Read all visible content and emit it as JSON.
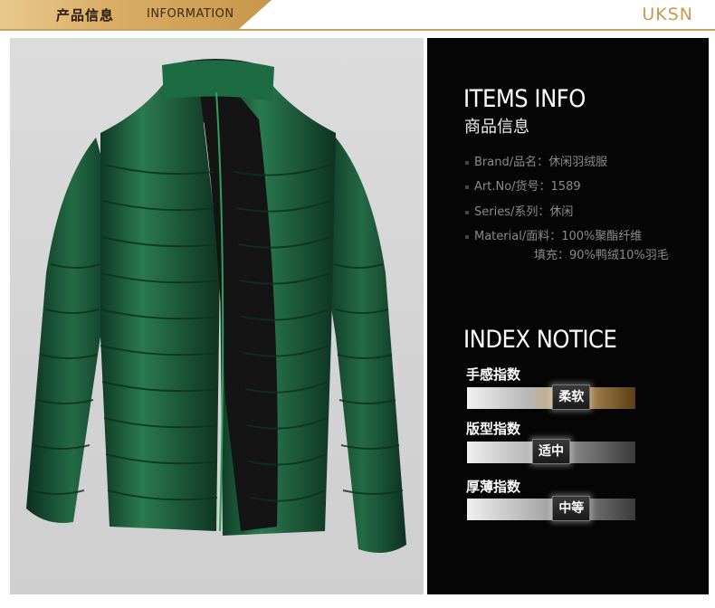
{
  "header": {
    "title_cn": "产品信息",
    "title_en": "INFORMATION",
    "brand_logo": "UKSN",
    "accent_color": "#c9a060"
  },
  "product_image": {
    "subject": "green down jacket",
    "jacket_color": "#1f5a3a",
    "lining_color": "#1b1b1b"
  },
  "items_info": {
    "title": "ITEMS INFO",
    "subtitle": "商品信息",
    "specs": [
      {
        "label": "Brand/品名：休闲羽绒服"
      },
      {
        "label": "Art.No/货号：1589"
      },
      {
        "label": "Series/系列：休闲"
      },
      {
        "label": "Material/面料：100%聚酯纤维"
      }
    ],
    "material_extra": "填充：90%鸭绒10%羽毛"
  },
  "index_notice": {
    "title": "INDEX NOTICE",
    "indexes": [
      {
        "label": "手感指数",
        "value": "柔软",
        "level": 0.62,
        "track": "gold"
      },
      {
        "label": "版型指数",
        "value": "适中",
        "level": 0.5,
        "track": "gray"
      },
      {
        "label": "厚薄指数",
        "value": "中等",
        "level": 0.62,
        "track": "gray"
      }
    ]
  }
}
